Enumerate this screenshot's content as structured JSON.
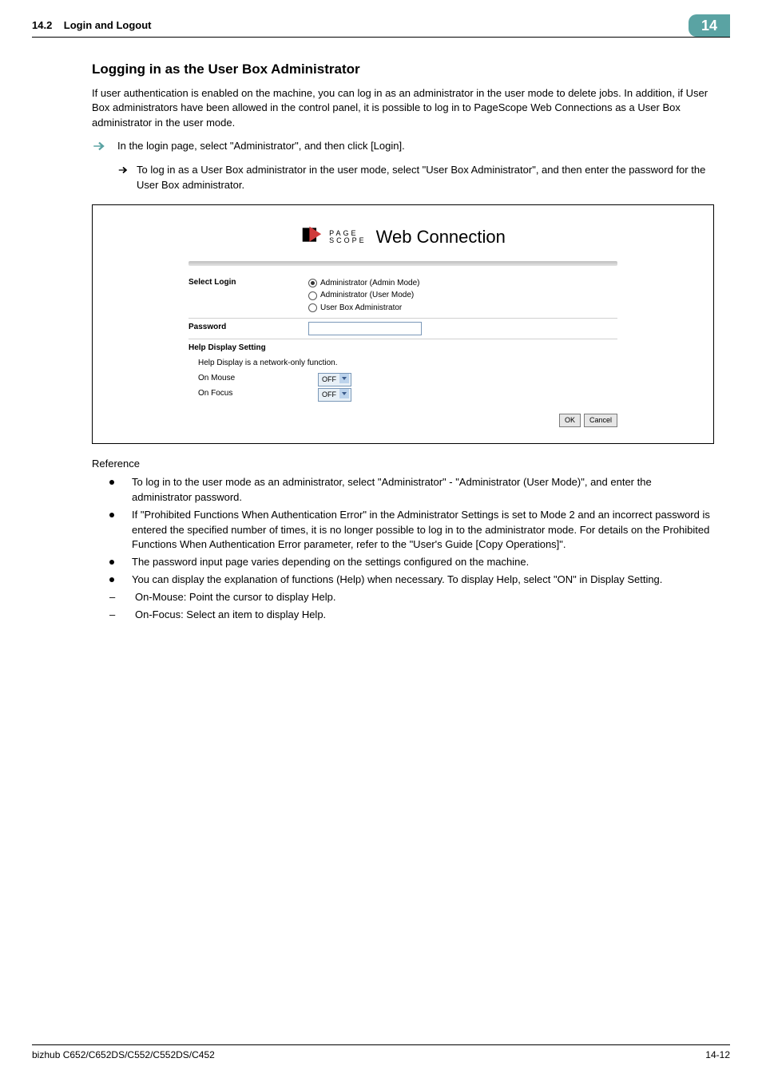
{
  "header": {
    "section_number": "14.2",
    "section_title": "Login and Logout",
    "chapter_badge": "14"
  },
  "title": "Logging in as the User Box Administrator",
  "intro": "If user authentication is enabled on the machine, you can log in as an administrator in the user mode to delete jobs. In addition, if User Box administrators have been allowed in the control panel, it is possible to log in to PageScope Web Connections as a User Box administrator in the user mode.",
  "step_main": "In the login page, select \"Administrator\", and then click [Login].",
  "step_sub": "To log in as a User Box administrator in the user mode, select \"User Box Administrator\", and then enter the password for the User Box administrator.",
  "screenshot": {
    "brand_line1": "PAGE",
    "brand_line2": "SCOPE",
    "brand_web": "Web Connection",
    "select_login_label": "Select Login",
    "radio_admin_mode": "Administrator (Admin Mode)",
    "radio_user_mode": "Administrator (User Mode)",
    "radio_userbox": "User Box Administrator",
    "password_label": "Password",
    "help_heading": "Help Display Setting",
    "help_note": "Help Display is a network-only function.",
    "on_mouse_label": "On Mouse",
    "on_focus_label": "On Focus",
    "on_mouse_value": "OFF",
    "on_focus_value": "OFF",
    "ok_label": "OK",
    "cancel_label": "Cancel"
  },
  "reference_heading": "Reference",
  "reference": {
    "b1": "To log in to the user mode as an administrator, select \"Administrator\" - \"Administrator (User Mode)\", and enter the administrator password.",
    "b2": "If \"Prohibited Functions When Authentication Error\" in the Administrator Settings is set to Mode 2 and an incorrect password is entered the specified number of times, it is no longer possible to log in to the administrator mode. For details on the Prohibited Functions When Authentication Error parameter, refer to the \"User's Guide [Copy Operations]\".",
    "b3": "The password input page varies depending on the settings configured on the machine.",
    "b4": "You can display the explanation of functions (Help) when necessary. To display Help, select \"ON\" in Display Setting.",
    "d1": "On-Mouse: Point the cursor to display Help.",
    "d2": "On-Focus: Select an item to display Help."
  },
  "footer": {
    "left": "bizhub C652/C652DS/C552/C552DS/C452",
    "right": "14-12"
  }
}
